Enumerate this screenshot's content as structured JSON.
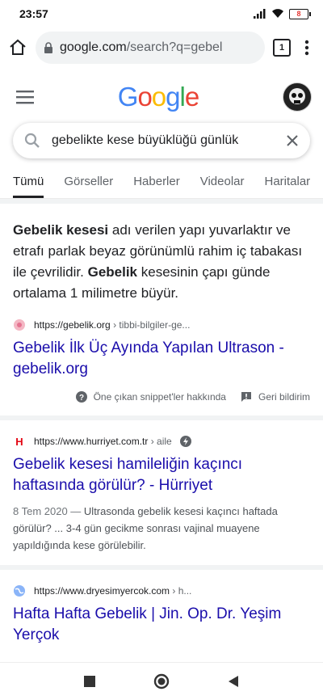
{
  "status": {
    "time": "23:57",
    "battery": "8"
  },
  "browser": {
    "url_host": "google.com",
    "url_rest": "/search?q=gebel",
    "tab_count": "1"
  },
  "google": {
    "logo_letters": [
      "G",
      "o",
      "o",
      "g",
      "l",
      "e"
    ],
    "logo_colors": [
      "#4285f4",
      "#ea4335",
      "#fbbc05",
      "#4285f4",
      "#34a853",
      "#ea4335"
    ]
  },
  "search": {
    "query": "gebelikte kese büyüklüğü günlük"
  },
  "tabs": [
    "Tümü",
    "Görseller",
    "Haberler",
    "Videolar",
    "Haritalar"
  ],
  "featured": {
    "snippet": {
      "b1": "Gebelik kesesi",
      "t1": " adı verilen yapı yuvarlaktır ve etrafı parlak beyaz görünümlü rahim iç tabakası ile çevrilidir. ",
      "b2": "Gebelik",
      "t2": " kesesinin çapı günde ortalama 1 milimetre büyür."
    },
    "cite_host": "https://gebelik.org",
    "cite_crumb": " › tibbi-bilgiler-ge...",
    "title": "Gebelik İlk Üç Ayında Yapılan Ultrason - gebelik.org",
    "about_snippets": "Öne çıkan snippet'ler hakkında",
    "feedback": "Geri bildirim"
  },
  "results": [
    {
      "cite_host": "https://www.hurriyet.com.tr",
      "cite_crumb": " › aile",
      "title": "Gebelik kesesi hamileliğin kaçıncı haftasında görülür? - Hürriyet",
      "date": "8 Tem 2020 — ",
      "desc": "Ultrasonda gebelik kesesi kaçıncı haftada görülür? ... 3-4 gün gecikme sonrası vajinal muayene yapıldığında kese görülebilir."
    },
    {
      "cite_host": "https://www.dryesimyercok.com",
      "cite_crumb": " › h...",
      "title": "Hafta Hafta Gebelik | Jin. Op. Dr. Yeşim Yerçok"
    }
  ],
  "icons": [
    "home-icon",
    "lock-icon",
    "tabs-icon",
    "menu-icon",
    "search-icon",
    "clear-icon",
    "help-icon",
    "feedback-icon",
    "amp-icon",
    "stop-icon",
    "home-nav-icon",
    "back-icon"
  ]
}
